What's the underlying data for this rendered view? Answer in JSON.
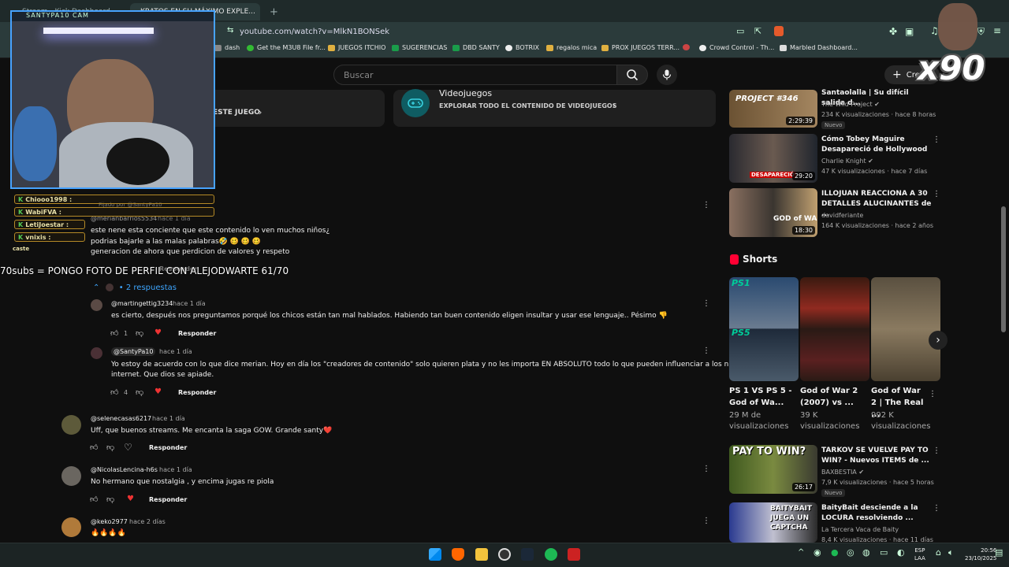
{
  "browser": {
    "tabs": [
      {
        "label": "Stream - Kick Dashboard"
      },
      {
        "label": "KRATOS EN SU MÁXIMO EXPLE..."
      }
    ],
    "url": "youtube.com/watch?v=MlkN1BONSek",
    "bookmarks": [
      "dash",
      "Get the M3U8 File fr...",
      "JUEGOS ITCHIO",
      "SUGERENCIAS",
      "DBD SANTY",
      "BOTRIX",
      "regalos mica",
      "PROX JUEGOS TERR...",
      "Crowd Control - Th...",
      "Marbled Dashboard..."
    ]
  },
  "youtube": {
    "search_placeholder": "Buscar",
    "create_label": "Crear",
    "cards": {
      "left_link": "ESTE JUEGO",
      "right_title": "Videojuegos",
      "right_link": "EXPLORAR TODO EL CONTENIDO DE VIDEOJUEGOS"
    },
    "pinned": {
      "pinned_by": "Fijado por @SantyPa10",
      "author": "@merianbarrios5534",
      "time": "hace 1 día",
      "lines": [
        "este nene esta conciente que este contenido lo ven muchos niños¿",
        "podrias bajarle a las malas palabras🤣 🥴 🥴 🥴",
        "generacion de ahora que perdicion de valores y respeto"
      ],
      "reply": "Responder"
    },
    "replies_toggle": "2 respuestas",
    "replies": [
      {
        "author": "@martingettig3234",
        "time": "hace 1 día",
        "text": "es cierto, después nos preguntamos porqué los chicos están tan mal hablados. Habiendo tan buen contenido eligen insultar y usar ese lenguaje.. Pésimo 👎",
        "likes": "1",
        "reply": "Responder"
      },
      {
        "author": "@SantyPa10",
        "time": "hace 1 día",
        "text": "Yo estoy de acuerdo con lo que dice merian. Hoy en día los \"creadores de contenido\" solo quieren plata y no les importa EN ABSOLUTO todo lo que pueden influenciar a los niños en el",
        "text2": "internet. Que dios se apiade.",
        "likes": "4",
        "reply": "Responder"
      }
    ],
    "comments": [
      {
        "author": "@selenecasas6217",
        "time": "hace 1 día",
        "text": "Uff, que buenos streams. Me encanta la saga GOW. Grande santy❤️",
        "reply": "Responder"
      },
      {
        "author": "@NicolasLencina-h6s",
        "time": "hace 1 día",
        "text": "No hermano que nostalgia , y encima jugas re piola",
        "reply": "Responder"
      },
      {
        "author": "@keko2977",
        "time": "hace 2 días",
        "text": "🔥🔥🔥🔥"
      }
    ],
    "sidebar": [
      {
        "title": "Santaolalla | Su difícil salida d...",
        "channel": "The Wild Project",
        "meta": "234 K visualizaciones · hace 8 horas",
        "duration": "2:29:39",
        "badge": "Nuevo",
        "thumb_text": "PROJECT #346"
      },
      {
        "title": "Cómo Tobey Maguire Desapareció de Hollywood",
        "channel": "Charlie Knight",
        "meta": "47 K visualizaciones · hace 7 días",
        "duration": "29:20",
        "thumb_text": "DESAPARECIÓ"
      },
      {
        "title": "ILLOJUAN REACCIONA A 30 DETALLES ALUCINANTES de ...",
        "channel": "davidferiante",
        "meta": "164 K visualizaciones · hace 2 años",
        "duration": "18:30",
        "thumb_text": "GOD of WAR"
      },
      {
        "title": "TARKOV SE VUELVE PAY TO WIN? - Nuevos ITEMS de ...",
        "channel": "BAXBESTIA",
        "meta": "7,9 K visualizaciones · hace 5 horas",
        "duration": "26:17",
        "badge": "Nuevo",
        "thumb_text": "PAY TO WIN?"
      },
      {
        "title": "BaityBait desciende a la LOCURA resolviendo ...",
        "channel": "La Tercera Vaca de Baity",
        "meta": "8,4 K visualizaciones · hace 11 días",
        "thumb_text": "BAITYBAIT JUEGA UN CAPTCHA"
      }
    ],
    "shorts_label": "Shorts",
    "shorts": [
      {
        "title": "PS 1 VS PS 5 - God of Wa...",
        "views": "29 M de visualizaciones",
        "thumb_top": "PS1",
        "thumb_bottom": "PS5"
      },
      {
        "title": "God of War 2 (2007) vs ...",
        "views": "39 K visualizaciones"
      },
      {
        "title": "God of War 2 | The Real ...",
        "views": "992 K visualizaciones"
      }
    ]
  },
  "stream": {
    "cam_title": "SANTYPA10 CAM",
    "chat": [
      {
        "user": "Chiooo1998 :"
      },
      {
        "user": "WabiFVA :"
      },
      {
        "user": "LetiJoestar :"
      },
      {
        "user": "vnixis :"
      }
    ],
    "chat_tail": "caste",
    "overlay_text": "70subs = PONGO FOTO DE PERFIL CON ALEJODWARTE  61/70",
    "multiplier": "x90"
  },
  "taskbar": {
    "lang": "ESP",
    "lang2": "LAA",
    "time": "20:56",
    "date": "23/10/2025"
  }
}
